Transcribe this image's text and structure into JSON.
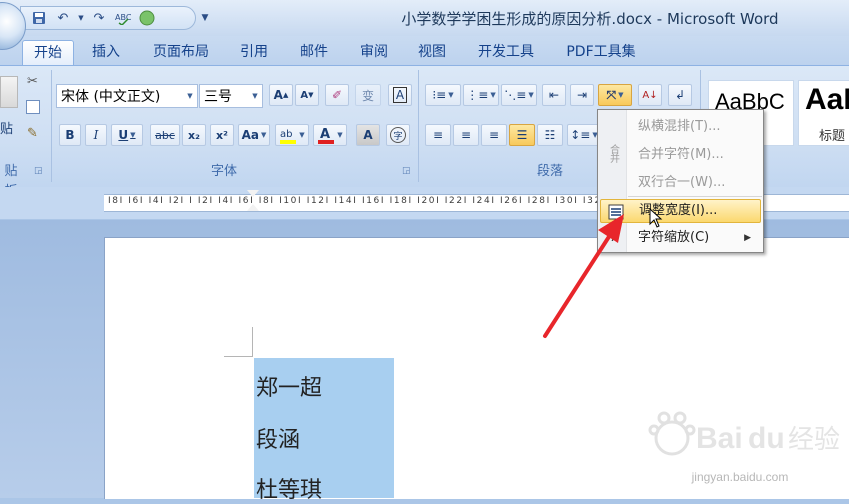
{
  "window": {
    "title": "小学数学学困生形成的原因分析.docx - Microsoft Word"
  },
  "tabs": [
    {
      "label": "开始",
      "active": true
    },
    {
      "label": "插入"
    },
    {
      "label": "页面布局"
    },
    {
      "label": "引用"
    },
    {
      "label": "邮件"
    },
    {
      "label": "审阅"
    },
    {
      "label": "视图"
    },
    {
      "label": "开发工具"
    },
    {
      "label": "PDF工具集"
    }
  ],
  "ribbon": {
    "clipboard": {
      "title": "贴板",
      "paste_label": "贴"
    },
    "font": {
      "title": "字体",
      "font_name": "宋体 (中文正文)",
      "font_size": "三号",
      "bold": "B",
      "italic": "I",
      "underline": "U",
      "strike": "abc",
      "subscript": "x₂",
      "superscript": "x²",
      "change_case": "Aa",
      "grow": "A",
      "shrink": "A",
      "clear": "A"
    },
    "paragraph": {
      "title": "段落"
    },
    "styles": [
      {
        "sample": "AaBbC",
        "name": ""
      },
      {
        "sample": "AaI",
        "name": "标题"
      }
    ]
  },
  "ruler": {
    "ticks": "I8I I6I I4I I2I I I2I I4I I6I I8I I10I I12I I14I I16I I18I I20I I22I I24I I26I I28I I30I I32I I34I I36I I38I I40I"
  },
  "document": {
    "lines": [
      "郑一超",
      "段涵",
      "杜等琪"
    ]
  },
  "menu": {
    "items": [
      {
        "label": "纵横混排(T)...",
        "enabled": false
      },
      {
        "label": "合并字符(M)...",
        "enabled": false
      },
      {
        "label": "双行合一(W)...",
        "enabled": false
      },
      {
        "label": "调整宽度(I)...",
        "enabled": true,
        "highlighted": true
      },
      {
        "label": "字符缩放(C)",
        "enabled": true,
        "submenu": true
      }
    ]
  },
  "watermark": {
    "brand": "Baidu经验",
    "url": "jingyan.baidu.com"
  },
  "colors": {
    "highlight_yellow": "#ffff00",
    "font_color_red": "#e02020",
    "menu_hover": "#fbd86f",
    "selection": "#a8cff0",
    "annotation_arrow": "#e8262b"
  }
}
